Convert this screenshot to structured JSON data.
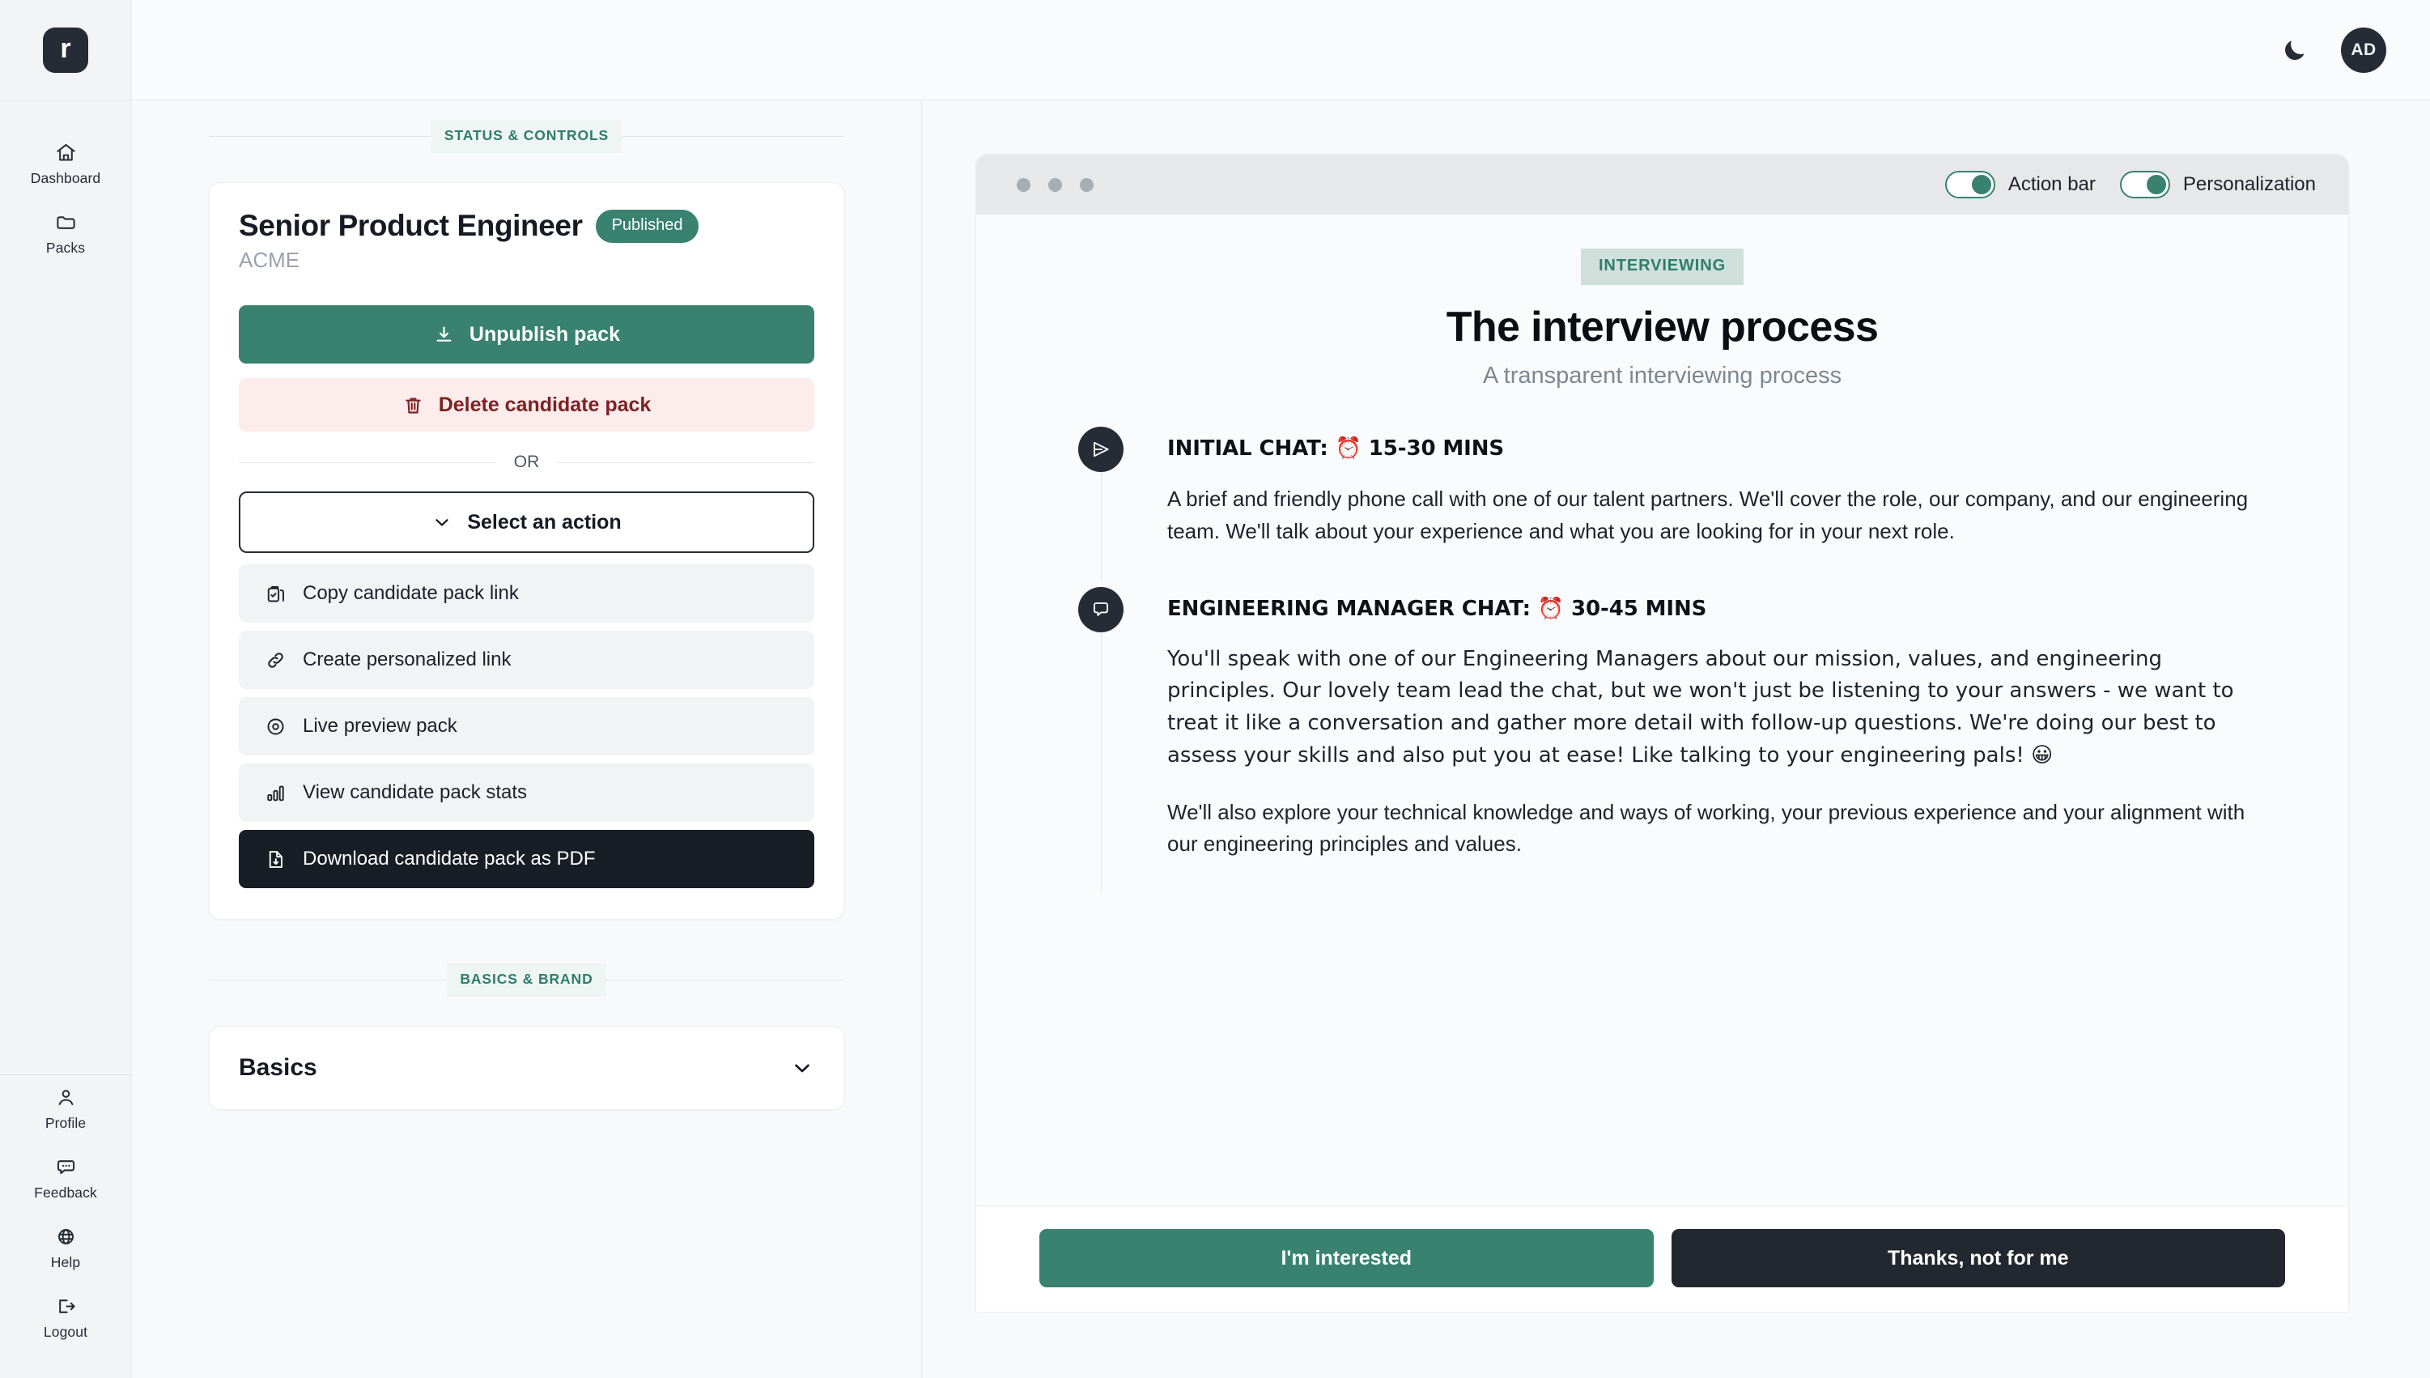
{
  "sidebar": {
    "logo_text": "r",
    "top_items": [
      {
        "label": "Dashboard",
        "icon": "home-icon"
      },
      {
        "label": "Packs",
        "icon": "folder-icon"
      }
    ],
    "bottom_items": [
      {
        "label": "Profile",
        "icon": "user-icon"
      },
      {
        "label": "Feedback",
        "icon": "chat-icon"
      },
      {
        "label": "Help",
        "icon": "globe-icon"
      },
      {
        "label": "Logout",
        "icon": "logout-icon"
      }
    ]
  },
  "header": {
    "theme_toggle_icon": "moon-icon",
    "avatar_initials": "AD"
  },
  "left": {
    "section_status_label": "STATUS & CONTROLS",
    "section_basics_label": "BASICS & BRAND",
    "job_title": "Senior Product Engineer",
    "status_badge": "Published",
    "company": "ACME",
    "unpublish_label": "Unpublish pack",
    "delete_label": "Delete candidate pack",
    "or_label": "OR",
    "select_action_label": "Select an action",
    "actions": [
      {
        "label": "Copy candidate pack link",
        "icon": "clipboard-copy-icon",
        "style": "light"
      },
      {
        "label": "Create personalized link",
        "icon": "link-icon",
        "style": "light"
      },
      {
        "label": "Live preview pack",
        "icon": "eye-icon",
        "style": "light"
      },
      {
        "label": "View candidate pack stats",
        "icon": "bar-chart-icon",
        "style": "light"
      },
      {
        "label": "Download candidate pack as PDF",
        "icon": "file-download-icon",
        "style": "dark"
      }
    ],
    "accordion_title": "Basics"
  },
  "preview": {
    "toggles": [
      {
        "label": "Action bar",
        "on": true
      },
      {
        "label": "Personalization",
        "on": true
      }
    ],
    "chip": "INTERVIEWING",
    "title": "The interview process",
    "subtitle": "A transparent interviewing process",
    "steps": [
      {
        "icon": "send-icon",
        "title": "INITIAL CHAT: ⏰ 15-30 MINS",
        "paragraphs": [
          "A brief and friendly phone call with one of our talent partners. We'll cover the role, our company, and our engineering team. We'll talk about your experience and what you are looking for in your next role."
        ]
      },
      {
        "icon": "speech-bubble-icon",
        "title": "ENGINEERING MANAGER CHAT: ⏰ 30-45 MINS",
        "paragraphs": [
          "You'll speak with one of our Engineering Managers about our mission, values, and engineering principles. Our lovely team lead the chat, but we won't just be listening to your answers - we want to treat it like a conversation and gather more detail with follow-up questions. We're doing our best to assess your skills and also put you at ease! Like talking to your engineering pals! 😀",
          "We'll also explore your technical knowledge and ways of working, your previous experience and your alignment with our engineering principles and values."
        ]
      }
    ],
    "cta_yes": "I'm interested",
    "cta_no": "Thanks, not for me"
  },
  "colors": {
    "accent_green": "#38826f",
    "dark": "#262b36",
    "danger_bg": "#fcecec",
    "danger_text": "#7c2222",
    "chip_bg": "#cfe0da"
  }
}
